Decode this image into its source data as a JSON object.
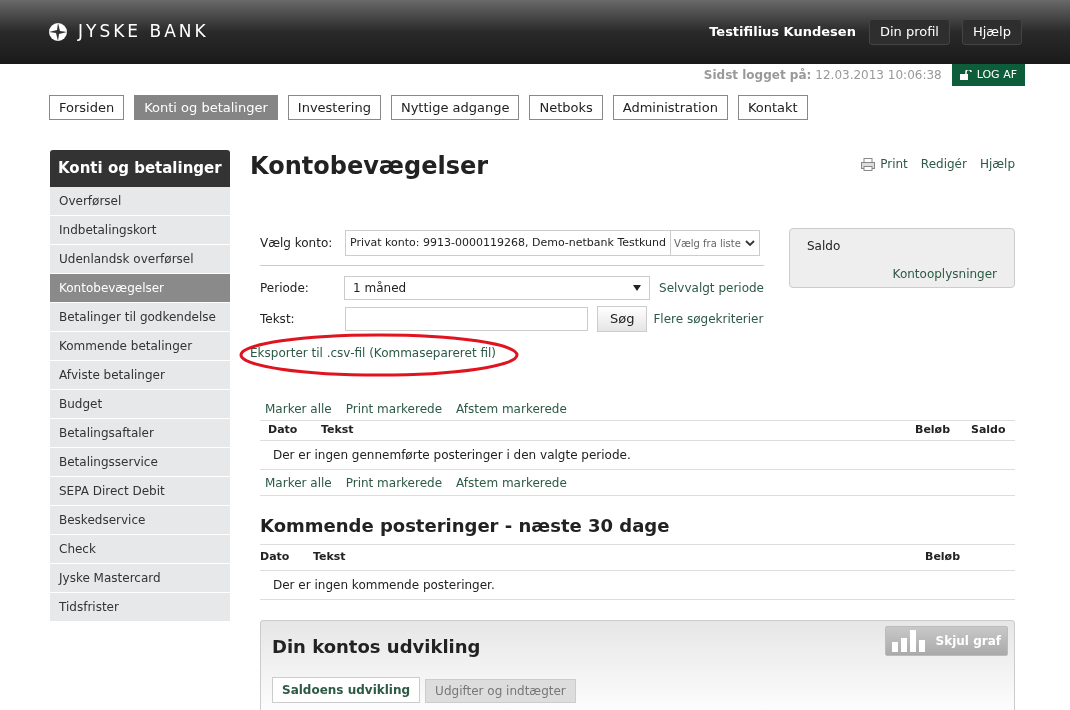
{
  "header": {
    "logo": "JYSKE BANK",
    "user": "Testifilius Kundesen",
    "buttons": [
      "Din profil",
      "Hjælp"
    ]
  },
  "login": {
    "label": "Sidst logget på:",
    "time": "12.03.2013 10:06:38",
    "logout": "LOG AF"
  },
  "nav": [
    {
      "label": "Forsiden",
      "selected": false
    },
    {
      "label": "Konti og betalinger",
      "selected": true
    },
    {
      "label": "Investering",
      "selected": false
    },
    {
      "label": "Nyttige adgange",
      "selected": false
    },
    {
      "label": "Netboks",
      "selected": false
    },
    {
      "label": "Administration",
      "selected": false
    },
    {
      "label": "Kontakt",
      "selected": false
    }
  ],
  "sidebar": {
    "title": "Konti og betalinger",
    "items": [
      {
        "label": "Overførsel",
        "selected": false
      },
      {
        "label": "Indbetalingskort",
        "selected": false
      },
      {
        "label": "Udenlandsk overførsel",
        "selected": false
      },
      {
        "label": "Kontobevægelser",
        "selected": true
      },
      {
        "label": "Betalinger til godkendelse",
        "selected": false
      },
      {
        "label": "Kommende betalinger",
        "selected": false
      },
      {
        "label": "Afviste betalinger",
        "selected": false
      },
      {
        "label": "Budget",
        "selected": false
      },
      {
        "label": "Betalingsaftaler",
        "selected": false
      },
      {
        "label": "Betalingsservice",
        "selected": false
      },
      {
        "label": "SEPA Direct Debit",
        "selected": false
      },
      {
        "label": "Beskedservice",
        "selected": false
      },
      {
        "label": "Check",
        "selected": false
      },
      {
        "label": "Jyske Mastercard",
        "selected": false
      },
      {
        "label": "Tidsfrister",
        "selected": false
      }
    ]
  },
  "page": {
    "title": "Kontobevægelser",
    "actions": [
      "Print",
      "Redigér",
      "Hjælp"
    ]
  },
  "form": {
    "account_label": "Vælg konto:",
    "account_value": "Privat konto: 9913-0000119268, Demo-netbank Testkund",
    "account_picker": "Vælg fra liste",
    "period_label": "Periode:",
    "period_value": "1 måned",
    "period_link": "Selvvalgt periode",
    "text_label": "Tekst:",
    "search_button": "Søg",
    "more_link": "Flere søgekriterier",
    "export_link": "Eksporter til .csv-fil (Kommasepareret fil)"
  },
  "balance_box": {
    "label": "Saldo",
    "link": "Kontooplysninger"
  },
  "actions_top": [
    "Marker alle",
    "Print markerede",
    "Afstem markerede"
  ],
  "transactions": {
    "columns": [
      "Dato",
      "Tekst",
      "Beløb",
      "Saldo"
    ],
    "empty": "Der er ingen gennemførte posteringer i den valgte periode."
  },
  "actions_bottom": [
    "Marker alle",
    "Print markerede",
    "Afstem markerede"
  ],
  "upcoming": {
    "title": "Kommende posteringer - næste 30 dage",
    "columns": [
      "Dato",
      "Tekst",
      "Beløb"
    ],
    "empty": "Der er ingen kommende posteringer."
  },
  "development": {
    "title": "Din kontos udvikling",
    "toggle": "Skjul graf",
    "tabs": [
      {
        "label": "Saldoens udvikling",
        "selected": true
      },
      {
        "label": "Udgifter og indtægter",
        "selected": false
      }
    ]
  }
}
